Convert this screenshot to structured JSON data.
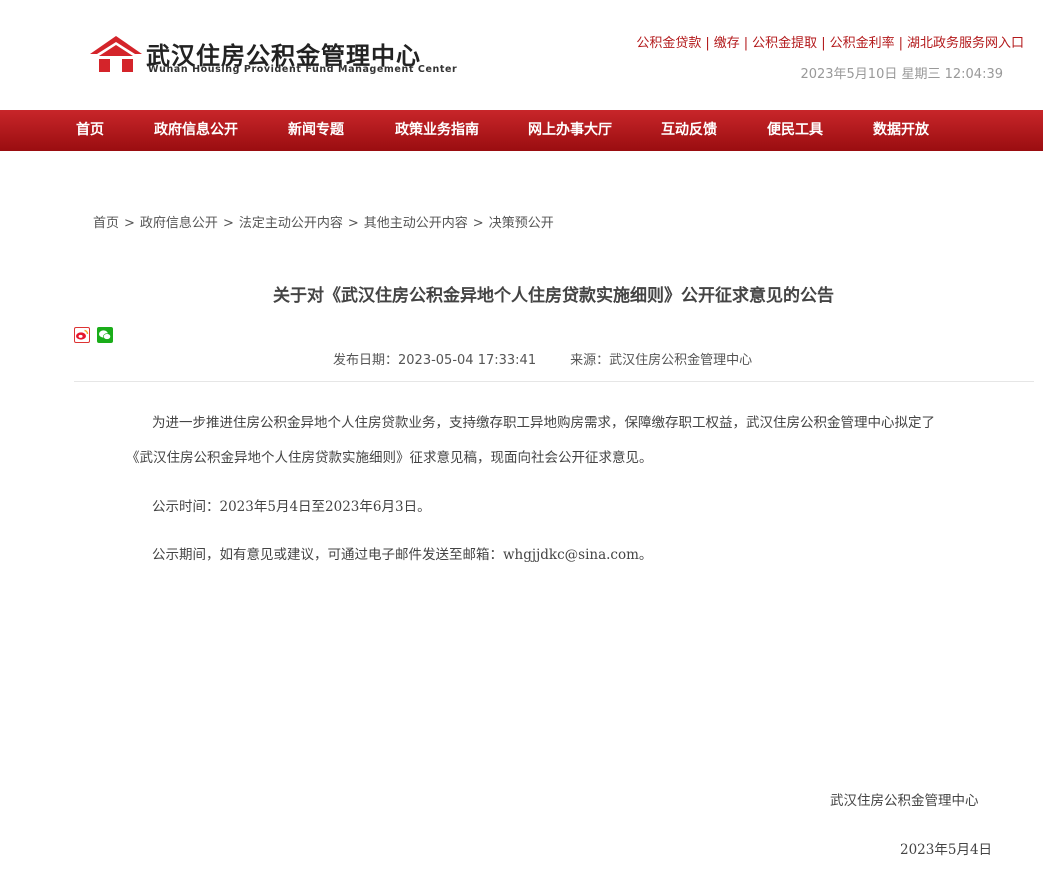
{
  "header": {
    "logo": {
      "cn": "武汉住房公积金管理中心",
      "en": "Wuhan Housing Provident Fund Management Center"
    },
    "top_links": [
      "公积金贷款",
      "缴存",
      "公积金提取",
      "公积金利率",
      "湖北政务服务网入口"
    ],
    "datetime": "2023年5月10日 星期三 12:04:39"
  },
  "nav": [
    "首页",
    "政府信息公开",
    "新闻专题",
    "政策业务指南",
    "网上办事大厅",
    "互动反馈",
    "便民工具",
    "数据开放"
  ],
  "breadcrumb": [
    "首页",
    "政府信息公开",
    "法定主动公开内容",
    "其他主动公开内容",
    "决策预公开"
  ],
  "article": {
    "title": "关于对《武汉住房公积金异地个人住房贷款实施细则》公开征求意见的公告",
    "publish_label": "发布日期：",
    "publish_date": "2023-05-04 17:33:41",
    "source_label": "来源：",
    "source": "武汉住房公积金管理中心",
    "p1_line1": "为进一步推进住房公积金异地个人住房贷款业务，支持缴存职工异地购房需求，保障缴存职工权益，武汉住房公积金管理中心拟定了",
    "p1_line2": "《武汉住房公积金异地个人住房贷款实施细则》征求意见稿，现面向社会公开征求意见。",
    "p2_label": "公示时间：",
    "p2_value": "2023年5月4日至2023年6月3日。",
    "p3_label": "公示期间，如有意见或建议，可通过电子邮件发送至邮箱：",
    "p3_email": "whgjjdkc@sina.com。",
    "sign_org": "武汉住房公积金管理中心",
    "sign_date": "2023年5月4日"
  },
  "colors": {
    "brand_red": "#b3191b",
    "nav_red": "#c8262a"
  }
}
